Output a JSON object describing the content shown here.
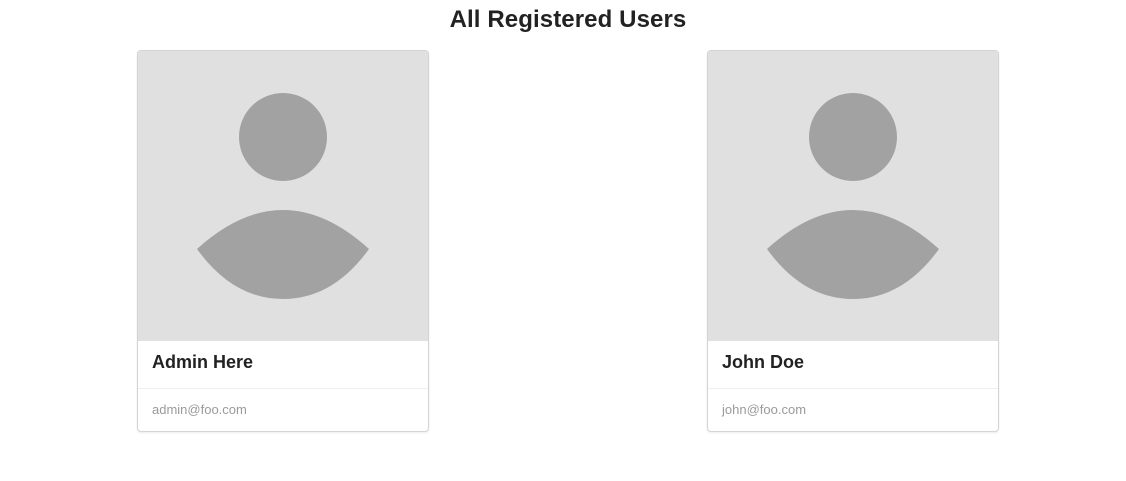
{
  "page": {
    "title": "All Registered Users"
  },
  "users": [
    {
      "name": "Admin Here",
      "email": "admin@foo.com",
      "avatar_icon": "user-placeholder-icon"
    },
    {
      "name": "John Doe",
      "email": "john@foo.com",
      "avatar_icon": "user-placeholder-icon"
    }
  ],
  "colors": {
    "avatar_background": "#e0e0e0",
    "avatar_silhouette": "#a2a2a2",
    "card_border": "#d4d4d5",
    "email_text": "#9a9a9a"
  }
}
